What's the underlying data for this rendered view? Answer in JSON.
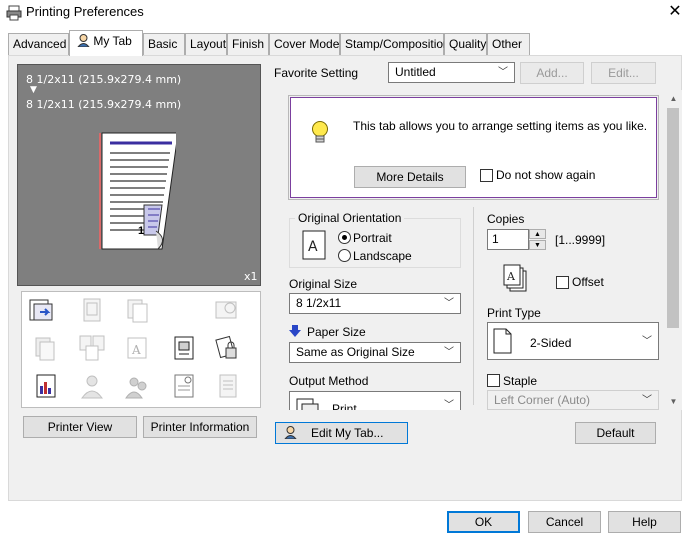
{
  "window": {
    "title": "Printing Preferences"
  },
  "tabs": [
    {
      "label": "Advanced"
    },
    {
      "label": "My Tab",
      "active": true
    },
    {
      "label": "Basic"
    },
    {
      "label": "Layout"
    },
    {
      "label": "Finish"
    },
    {
      "label": "Cover Mode"
    },
    {
      "label": "Stamp/Composition"
    },
    {
      "label": "Quality"
    },
    {
      "label": "Other"
    }
  ],
  "preview": {
    "paper_line1": "8 1/2x11 (215.9x279.4 mm)",
    "arrow": "▼",
    "paper_line2": "8 1/2x11 (215.9x279.4 mm)",
    "multiplier": "x1",
    "page_number": "1"
  },
  "preview_buttons": {
    "printer_view": "Printer View",
    "printer_information": "Printer Information"
  },
  "favorite": {
    "label": "Favorite Setting",
    "selected": "Untitled",
    "add_label": "Add...",
    "edit_label": "Edit..."
  },
  "info": {
    "message": "This tab allows you to arrange setting items as you like.",
    "more_details": "More Details",
    "dont_show": "Do not show again"
  },
  "orientation": {
    "label": "Original Orientation",
    "portrait": "Portrait",
    "landscape": "Landscape",
    "selected": "Portrait"
  },
  "original_size": {
    "label": "Original Size",
    "value": "8 1/2x11"
  },
  "paper_size": {
    "label": "Paper Size",
    "value": "Same as Original Size"
  },
  "output_method": {
    "label": "Output Method",
    "value": "Print"
  },
  "copies": {
    "label": "Copies",
    "value": "1",
    "range": "[1...9999]"
  },
  "offset": {
    "label": "Offset"
  },
  "print_type": {
    "label": "Print Type",
    "value": "2-Sided"
  },
  "staple": {
    "label": "Staple",
    "value": "Left Corner (Auto)"
  },
  "bottom": {
    "edit_my_tab": "Edit My Tab...",
    "default": "Default"
  },
  "dialog_buttons": {
    "ok": "OK",
    "cancel": "Cancel",
    "help": "Help"
  },
  "colors": {
    "accent": "#0078d7",
    "info_border": "#7b3f9e",
    "preview_bg": "#7f7f7f"
  }
}
